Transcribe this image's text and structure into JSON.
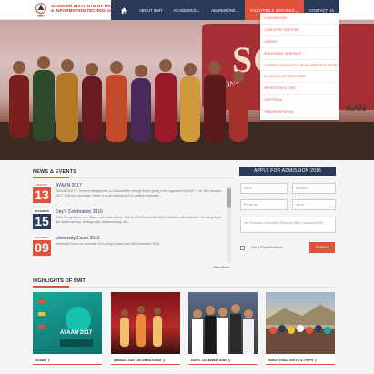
{
  "header": {
    "brand_line1": "SANSKAR INSTITUTE OF MANAGEMENT",
    "brand_line2": "& INFORMATION TECHNOLOGY",
    "logo_text": "SIMIT",
    "nav": [
      "ABOUT SMIT",
      "ACADEMICS ⌄",
      "ADMISSIONS ⌄",
      "FACILITIES & SERVICES ⌄",
      "CONTACT US"
    ],
    "accent": "#e0523c",
    "navy": "#2a3a59"
  },
  "dropdown": {
    "items": [
      "CLASSROOMS",
      "COMPUTER CENTERS",
      "LIBRARY",
      "PLACEMENT SERVICES",
      "CAREER GUIDANCE FOR HIGHER EDUCATION",
      "SCHOLARSHIP SERVICES",
      "SPORTS FACILITIES",
      "CAFETERIA",
      "TRANSPORTATION"
    ]
  },
  "hero": {
    "banner_text": "SO",
    "banner_sub": "ONS",
    "banner_side": "AAN"
  },
  "news": {
    "title": "NEWS & EVENTS",
    "items": [
      {
        "month": "JANUARY",
        "day": "13",
        "heading": "AYAAN 2017",
        "body": "\"AYAAN 2017\" - Techno management & Cultural inter-college fest is going to be organised by S.M.I.T on 10th January 2017. This time its bigger, better & more exciting as it is getting expanded ..."
      },
      {
        "month": "DECEMBER",
        "day": "15",
        "heading": "Day's Celebration 2016",
        "body": "S.M.I.T is going to have Days' celebrations from 15th to 22nd December 2016. Students will celebrate 7 exciting days like traditional day, heritage day, babyhood day, etc..."
      },
      {
        "month": "NOVEMBER",
        "day": "09",
        "heading": "University Exam 2016",
        "body": "University Exam for semester III is going to start from 9th November 2016."
      }
    ],
    "view_more": "- View More"
  },
  "admission": {
    "title": "APPLY FOR ADMISSION 2016",
    "name_placeholder": "Name",
    "email_placeholder": "Email Id",
    "phone_placeholder": "Phone No.",
    "select_placeholder": "Select",
    "query_placeholder": "Any Particular Information Required (Max Characters:500)",
    "brochure_label": "Get A Free Brochure",
    "submit_label": "SUBMIT"
  },
  "highlights": {
    "title": "HIGHLIGHTS OF SMIT",
    "cards": [
      {
        "caption": "AYAAN",
        "poster_text": "AYAAN 2017"
      },
      {
        "caption": "ANNUAL DAY CELEBRATIONS"
      },
      {
        "caption": "DAYS' CELEBRATIONS"
      },
      {
        "caption": "INDUSTRIAL VISITS & TRIPS"
      }
    ]
  }
}
